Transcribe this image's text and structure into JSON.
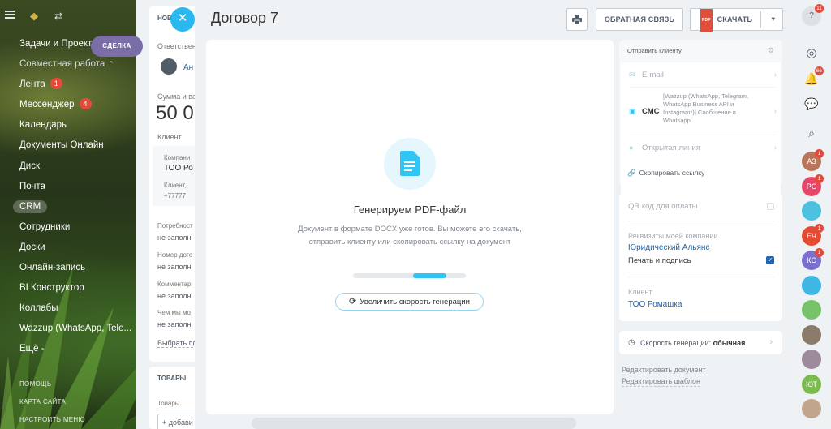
{
  "left_sidebar": {
    "items": [
      {
        "label": "Задачи и Проекты",
        "type": "item"
      },
      {
        "label": "Совместная работа",
        "type": "group"
      },
      {
        "label": "Лента",
        "counter": "1"
      },
      {
        "label": "Мессенджер",
        "counter": "4"
      },
      {
        "label": "Календарь"
      },
      {
        "label": "Документы Онлайн"
      },
      {
        "label": "Диск"
      },
      {
        "label": "Почта"
      },
      {
        "label": "CRM",
        "type": "pill"
      },
      {
        "label": "Сотрудники"
      },
      {
        "label": "Доски"
      },
      {
        "label": "Онлайн-запись"
      },
      {
        "label": "BI Конструктор"
      },
      {
        "label": "Коллабы"
      },
      {
        "label": "Wazzup (WhatsApp, Tele..."
      },
      {
        "label": "Ещё -"
      }
    ],
    "bottom_links": [
      "ПОМОЩЬ",
      "КАРТА САЙТА",
      "НАСТРОИТЬ МЕНЮ"
    ]
  },
  "deal_tag": "СДЕЛКА",
  "deal_behind": {
    "tab": "НОВ",
    "responsible_label": "Ответствен",
    "responsible_name": "Ан",
    "sum_label": "Сумма и ва",
    "sum_value": "50 0",
    "client_label": "Клиент",
    "company_label": "Компани",
    "company_name": "ТОО Ро",
    "client_contact": "Клиент,",
    "phone": "+77777",
    "need_label": "Потребност",
    "empty1": "не заполн",
    "contract_label": "Номер дого",
    "empty2": "не заполн",
    "comment_label": "Комментар",
    "empty3": "не заполн",
    "what_label": "Чем мы мо",
    "empty4": "не заполн",
    "choose_field": "Выбрать по",
    "goods_tab": "ТОВАРЫ",
    "goods_label": "Товары",
    "add_goods": "+ добави"
  },
  "slider": {
    "title": "Договор 7",
    "feedback_label": "ОБРАТНАЯ СВЯЗЬ",
    "download_label": "СКАЧАТЬ",
    "pdf_badge": "PDF"
  },
  "generation": {
    "title": "Генерируем PDF-файл",
    "description": "Документ в формате DOCX уже готов. Вы можете его скачать, отправить клиенту или скопировать ссылку на документ",
    "progress_fraction": 0.3,
    "speedup_label": "Увеличить скорость генерации"
  },
  "send_panel": {
    "header": "Отправить клиенту",
    "email_label": "E-mail",
    "sms_label": "СМС",
    "sms_sub": "[Wazzup (WhatsApp, Telegram, WhatsApp Business API и Instagram*)] Сообщение в Whatsapp",
    "openline_label": "Открытая линия",
    "copy_link": "Скопировать ссылку"
  },
  "details_panel": {
    "qr_label": "QR код для оплаты",
    "requisites_label": "Реквизиты моей компании",
    "company_link": "Юридический Альянс",
    "sign_label": "Печать и подпись",
    "client_label": "Клиент",
    "client_link": "ТОО Ромашка"
  },
  "speed_panel": {
    "label": "Скорость генерации:",
    "value": "обычная"
  },
  "edit_links": {
    "edit_doc": "Редактировать документ",
    "edit_template": "Редактировать шаблон"
  },
  "right_sidebar": {
    "help_badge": "11",
    "notif_badge": "66",
    "avatars": [
      {
        "initials": "АЗ",
        "color": "#b9765a",
        "badge": "1"
      },
      {
        "initials": "РС",
        "color": "#e8456a",
        "badge": "1"
      },
      {
        "initials": "",
        "color": "#4cc2e0",
        "badge": ""
      },
      {
        "initials": "ЕЧ",
        "color": "#e34a2f",
        "badge": "1"
      },
      {
        "initials": "КС",
        "color": "#7b6fd0",
        "badge": "1"
      },
      {
        "initials": "",
        "color": "#3fb7e5",
        "badge": ""
      },
      {
        "initials": "",
        "color": "#76c36a",
        "badge": ""
      },
      {
        "initials": "",
        "color": "#8a7b6a",
        "badge": ""
      },
      {
        "initials": "",
        "color": "#9d8a9a",
        "badge": ""
      },
      {
        "initials": "ЮТ",
        "color": "#7bbd4c",
        "badge": ""
      },
      {
        "initials": "",
        "color": "#c2a68c",
        "badge": ""
      }
    ]
  },
  "colors": {
    "accent": "#2fc6f6",
    "link": "#2066b0",
    "badge": "#e24b3b"
  }
}
